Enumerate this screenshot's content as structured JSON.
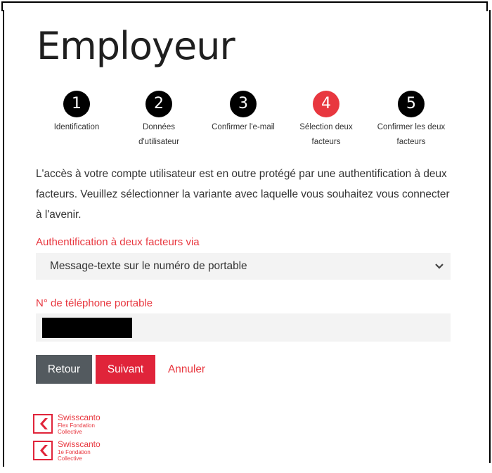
{
  "page": {
    "title": "Employeur"
  },
  "stepper": {
    "steps": [
      {
        "number": "1",
        "label": "Identification",
        "state": "done"
      },
      {
        "number": "2",
        "label": "Données d'utilisateur",
        "state": "done"
      },
      {
        "number": "3",
        "label": "Confirmer l'e-mail",
        "state": "done"
      },
      {
        "number": "4",
        "label": "Sélection deux facteurs",
        "state": "active"
      },
      {
        "number": "5",
        "label": "Confirmer les deux facteurs",
        "state": "pending"
      }
    ]
  },
  "intro": {
    "text": "L'accès à votre compte utilisateur est en outre protégé par une authentification à deux facteurs. Veuillez sélectionner la variante avec laquelle vous souhaitez vous connecter à l'avenir."
  },
  "form": {
    "auth_label": "Authentification à deux facteurs via",
    "auth_selected": "Message-texte sur le numéro de portable",
    "phone_label": "N° de téléphone portable",
    "phone_value": "[redacted]"
  },
  "actions": {
    "back_label": "Retour",
    "next_label": "Suivant",
    "cancel_label": "Annuler"
  },
  "footer": {
    "logos": [
      {
        "name": "Swisscanto",
        "sub_line1": "Flex Fondation",
        "sub_line2": "Collective"
      },
      {
        "name": "Swisscanto",
        "sub_line1": "1e Fondation",
        "sub_line2": "Collective"
      }
    ]
  },
  "colors": {
    "accent": "#e8373f",
    "step_inactive": "#000000",
    "button_secondary": "#535a5f",
    "field_background": "#f3f3f3"
  }
}
